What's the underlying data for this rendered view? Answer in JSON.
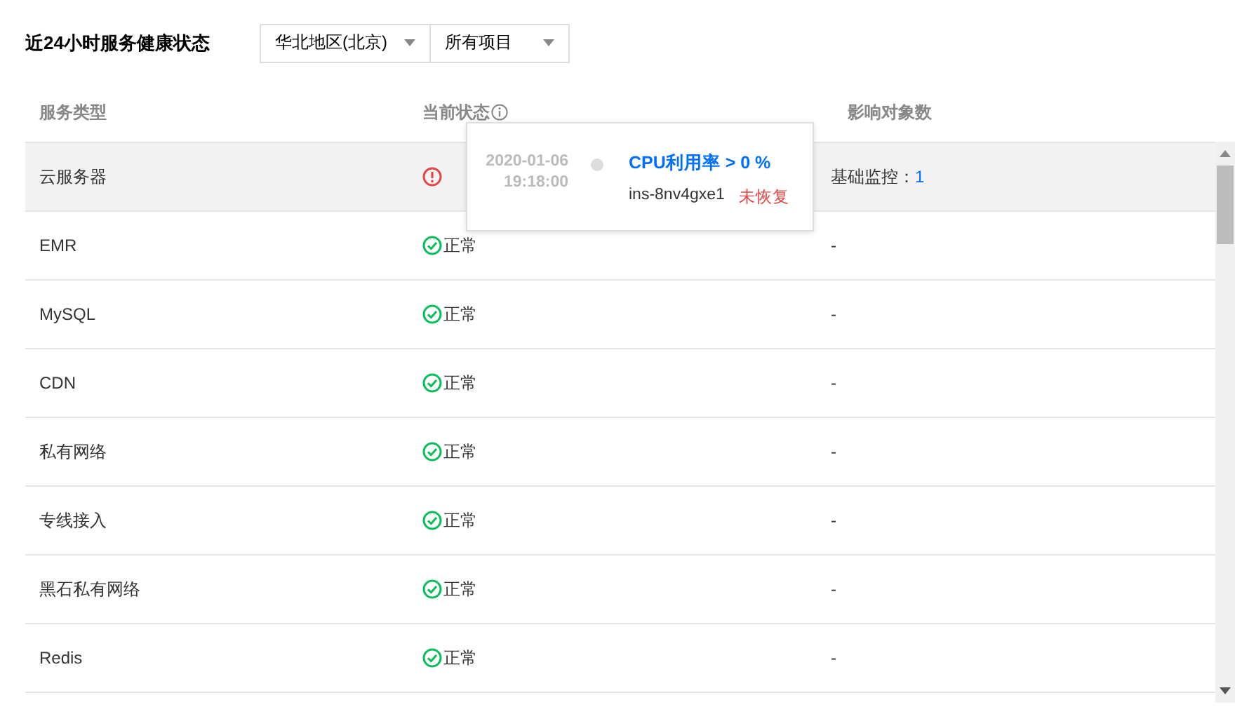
{
  "title": "近24小时服务健康状态",
  "filters": [
    {
      "value": "华北地区(北京)"
    },
    {
      "value": "所有项目"
    }
  ],
  "table": {
    "columns": [
      "服务类型",
      "当前状态",
      "影响对象数"
    ],
    "rows": [
      {
        "service": "云服务器",
        "kind": "error",
        "impact_label": "基础监控：",
        "impact_count": "1",
        "hovered": true
      },
      {
        "service": "EMR",
        "kind": "ok",
        "status_text": "正常",
        "impact": "-",
        "hovered": false
      },
      {
        "service": "MySQL",
        "kind": "ok",
        "status_text": "正常",
        "impact": "-",
        "hovered": false
      },
      {
        "service": "CDN",
        "kind": "ok",
        "status_text": "正常",
        "impact": "-",
        "hovered": false
      },
      {
        "service": "私有网络",
        "kind": "ok",
        "status_text": "正常",
        "impact": "-",
        "hovered": false
      },
      {
        "service": "专线接入",
        "kind": "ok",
        "status_text": "正常",
        "impact": "-",
        "hovered": false
      },
      {
        "service": "黑石私有网络",
        "kind": "ok",
        "status_text": "正常",
        "impact": "-",
        "hovered": false
      },
      {
        "service": "Redis",
        "kind": "ok",
        "status_text": "正常",
        "impact": "-",
        "hovered": false
      }
    ]
  },
  "tooltip": {
    "date": "2020-01-06",
    "time": "19:18:00",
    "metric": "CPU利用率 > 0 %",
    "instance": "ins-8nv4gxe1",
    "state": "未恢复"
  }
}
